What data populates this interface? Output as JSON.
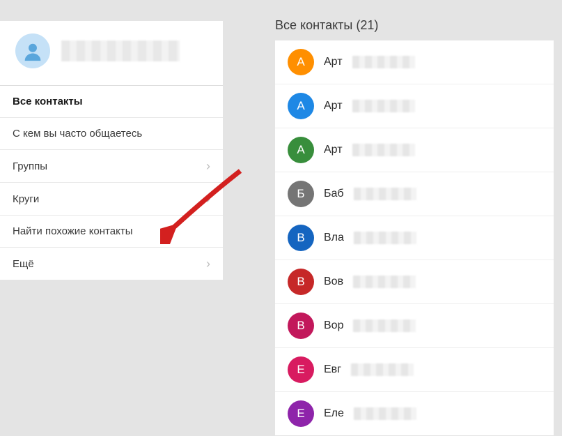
{
  "header_title": "Все контакты (21)",
  "sidebar_menu": [
    {
      "label": "Все контакты",
      "active": true,
      "chevron": false
    },
    {
      "label": "С кем вы часто общаетесь",
      "active": false,
      "chevron": false
    },
    {
      "label": "Группы",
      "active": false,
      "chevron": true
    },
    {
      "label": "Круги",
      "active": false,
      "chevron": true
    },
    {
      "label": "Найти похожие контакты",
      "active": false,
      "chevron": false
    },
    {
      "label": "Ещё",
      "active": false,
      "chevron": true
    }
  ],
  "contacts": [
    {
      "initial": "А",
      "prefix": "Арт",
      "color": "#ff8f00"
    },
    {
      "initial": "А",
      "prefix": "Арт",
      "color": "#1e88e5"
    },
    {
      "initial": "А",
      "prefix": "Арт",
      "color": "#388e3c"
    },
    {
      "initial": "Б",
      "prefix": "Баб",
      "color": "#757575"
    },
    {
      "initial": "В",
      "prefix": "Вла",
      "color": "#1565c0"
    },
    {
      "initial": "В",
      "prefix": "Вов",
      "color": "#c62828"
    },
    {
      "initial": "В",
      "prefix": "Вор",
      "color": "#c2185b"
    },
    {
      "initial": "Е",
      "prefix": "Евг",
      "color": "#d81b60"
    },
    {
      "initial": "Е",
      "prefix": "Еле",
      "color": "#8e24aa"
    }
  ]
}
